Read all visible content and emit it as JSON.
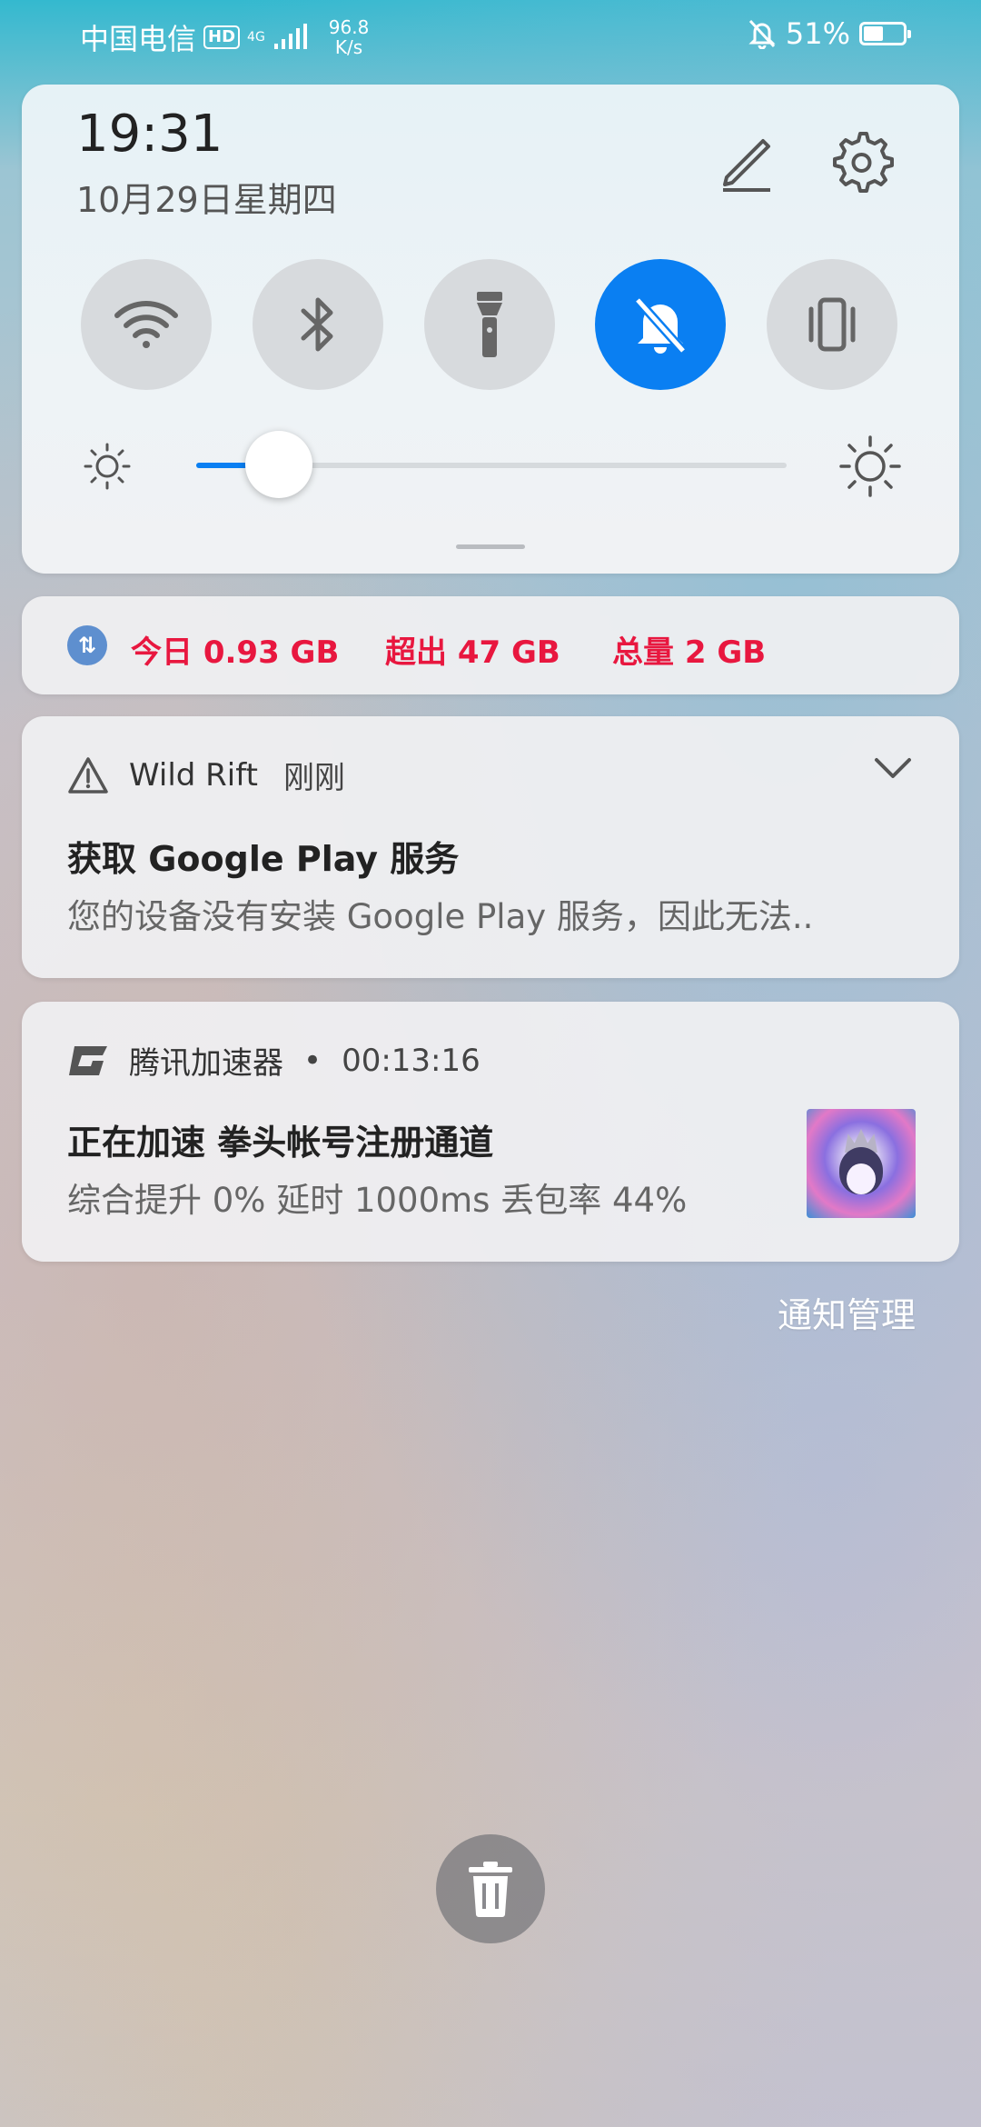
{
  "status_bar": {
    "carrier": "中国电信",
    "hd": "HD",
    "network": "4G",
    "speed_value": "96.8",
    "speed_unit": "K/s",
    "battery_percent": "51%",
    "battery_level": 0.51
  },
  "quick_settings": {
    "time": "19:31",
    "date": "10月29日星期四",
    "brightness_level": 0.14,
    "toggles": [
      {
        "name": "wifi",
        "active": false
      },
      {
        "name": "bluetooth",
        "active": false
      },
      {
        "name": "flashlight",
        "active": false
      },
      {
        "name": "do-not-disturb",
        "active": true
      },
      {
        "name": "vibrate",
        "active": false
      }
    ]
  },
  "data_usage": {
    "today": "今日 0.93 GB",
    "exceeded": "超出 47 GB",
    "total": "总量 2 GB"
  },
  "notifications": [
    {
      "app": "Wild Rift",
      "when": "刚刚",
      "title": "获取 Google Play 服务",
      "body": "您的设备没有安装 Google Play 服务，因此无法.."
    },
    {
      "app": "腾讯加速器",
      "separator": "•",
      "when": "00:13:16",
      "title": "正在加速 拳头帐号注册通道",
      "body": "综合提升 0%  延时 1000ms 丢包率 44%"
    }
  ],
  "manage_label": "通知管理",
  "colors": {
    "accent": "#0a7ff2",
    "data_text": "#e8173f"
  }
}
